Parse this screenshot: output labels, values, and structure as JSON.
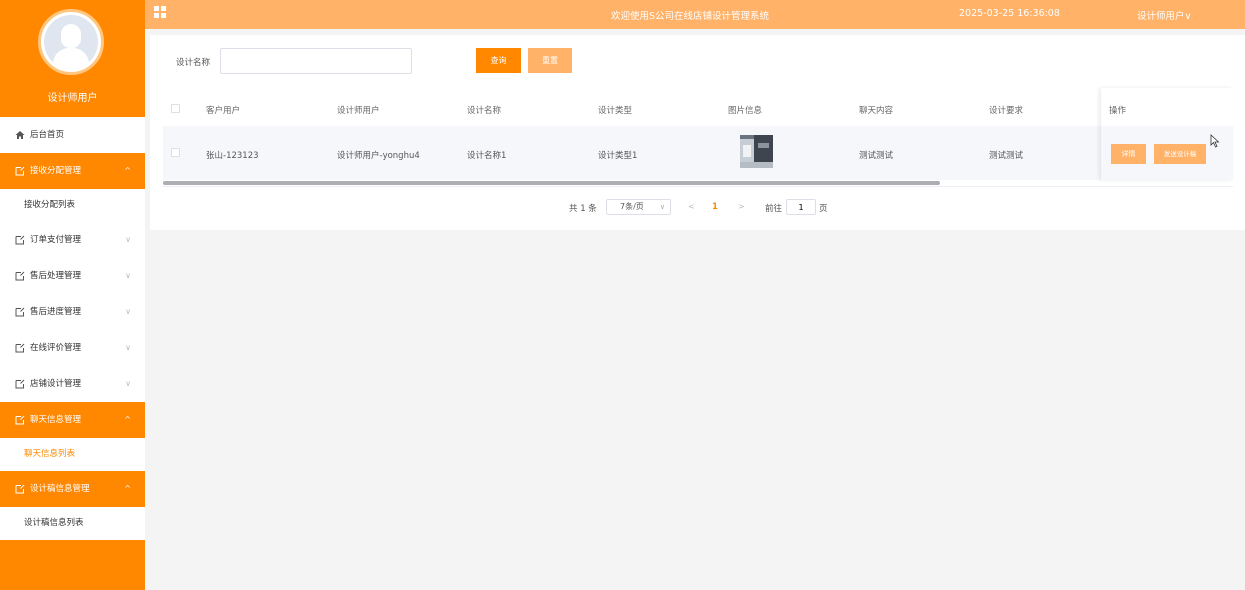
{
  "sidebar": {
    "user_name": "设计师用户",
    "menu": [
      {
        "label": "后台首页",
        "icon": "home-icon",
        "active": false,
        "chevron": ""
      },
      {
        "label": "接收分配管理",
        "icon": "menu-icon",
        "active": true,
        "chevron": "^"
      },
      {
        "label": "接收分配列表",
        "sub": true
      },
      {
        "label": "订单支付管理",
        "icon": "menu-icon",
        "active": false,
        "chevron": "∨"
      },
      {
        "label": "售后处理管理",
        "icon": "menu-icon",
        "active": false,
        "chevron": "∨"
      },
      {
        "label": "售后进度管理",
        "icon": "menu-icon",
        "active": false,
        "chevron": "∨"
      },
      {
        "label": "在线评价管理",
        "icon": "menu-icon",
        "active": false,
        "chevron": "∨"
      },
      {
        "label": "店铺设计管理",
        "icon": "menu-icon",
        "active": false,
        "chevron": "∨"
      },
      {
        "label": "聊天信息管理",
        "icon": "menu-icon",
        "active": true,
        "chevron": "^"
      },
      {
        "label": "聊天信息列表",
        "sub": true,
        "highlight": true
      },
      {
        "label": "设计稿信息管理",
        "icon": "menu-icon",
        "active": true,
        "chevron": "^"
      },
      {
        "label": "设计稿信息列表",
        "sub": true
      }
    ]
  },
  "topbar": {
    "title": "欢迎使用S公司在线店铺设计管理系统",
    "datetime": "2025-03-25 16:36:08",
    "user": "设计师用户∨"
  },
  "search": {
    "label": "设计名称",
    "value": "",
    "placeholder": "",
    "query_label": "查询",
    "reset_label": "重置"
  },
  "table": {
    "headers": {
      "customer": "客户用户",
      "designer": "设计师用户",
      "design_name": "设计名称",
      "design_type": "设计类型",
      "image": "图片信息",
      "chat": "聊天内容",
      "requirement": "设计要求",
      "actions": "操作"
    },
    "rows": [
      {
        "customer": "张山-123123",
        "designer": "设计师用户-yonghu4",
        "design_name": "设计名称1",
        "design_type": "设计类型1",
        "chat": "测试测试",
        "requirement": "测试测试",
        "detail_label": "详情",
        "send_label": "发送设计稿"
      }
    ]
  },
  "pagination": {
    "total": "共 1 条",
    "page_size": "7条/页",
    "current": "1",
    "goto": "前往",
    "goto_value": "1",
    "page_suffix": "页"
  }
}
